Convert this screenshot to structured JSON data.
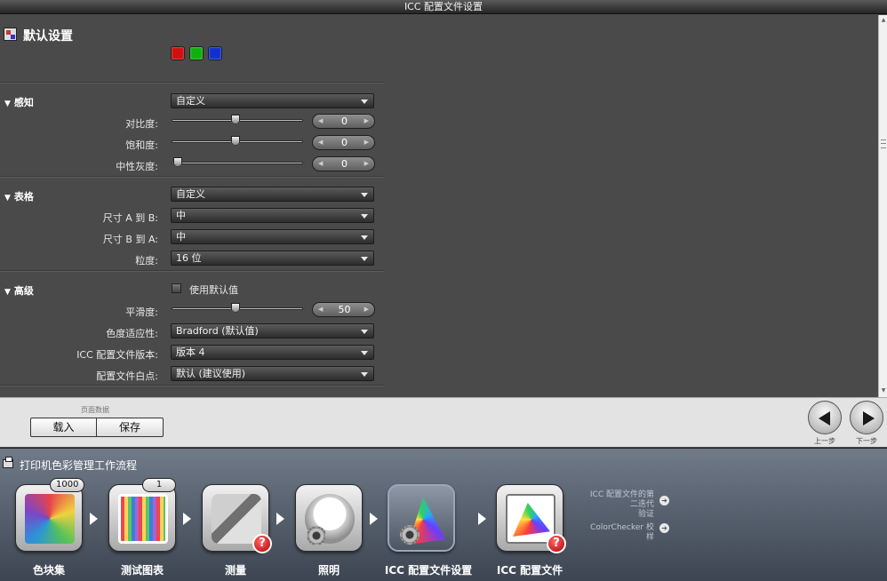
{
  "window": {
    "title": "ICC 配置文件设置"
  },
  "header": {
    "title": "默认设置",
    "swatches": [
      {
        "name": "red",
        "color": "#d01010"
      },
      {
        "name": "green",
        "color": "#10b010"
      },
      {
        "name": "blue",
        "color": "#1030d0"
      }
    ]
  },
  "perception": {
    "label": "感知",
    "mode": "自定义",
    "contrast": {
      "label": "对比度:",
      "value": "0",
      "level": 0.5
    },
    "saturation": {
      "label": "饱和度:",
      "value": "0",
      "level": 0.5
    },
    "neutral_gray": {
      "label": "中性灰度:",
      "value": "0",
      "level": 0.0
    }
  },
  "table": {
    "label": "表格",
    "mode": "自定义",
    "size_a_to_b": {
      "label": "尺寸 A 到 B:",
      "value": "中"
    },
    "size_b_to_a": {
      "label": "尺寸 B 到 A:",
      "value": "中"
    },
    "precision": {
      "label": "粒度:",
      "value": "16 位"
    }
  },
  "advanced": {
    "label": "高级",
    "use_default": "使用默认值",
    "smoothness": {
      "label": "平滑度:",
      "value": "50",
      "level": 0.5
    },
    "chromatic_adaptation": {
      "label": "色度适应性:",
      "value": "Bradford (默认值)"
    },
    "icc_version": {
      "label": "ICC 配置文件版本:",
      "value": "版本 4"
    },
    "white_point": {
      "label": "配置文件白点:",
      "value": "默认 (建议使用)"
    }
  },
  "footer": {
    "page_data": "页面数据",
    "load": "载入",
    "save": "保存",
    "prev": "上一步",
    "next": "下一步"
  },
  "workflow": {
    "title": "打印机色彩管理工作流程",
    "steps": [
      {
        "label": "色块集",
        "badge": "1000"
      },
      {
        "label": "测试图表",
        "badge": "1"
      },
      {
        "label": "测量"
      },
      {
        "label": "照明"
      },
      {
        "label": "ICC 配置文件设置"
      },
      {
        "label": "ICC 配置文件"
      }
    ],
    "side_links": [
      {
        "line1": "ICC 配置文件的第",
        "line2": "二迭代",
        "line3": "验证"
      },
      {
        "line1": "ColorChecker 校",
        "line2": "样"
      }
    ]
  }
}
